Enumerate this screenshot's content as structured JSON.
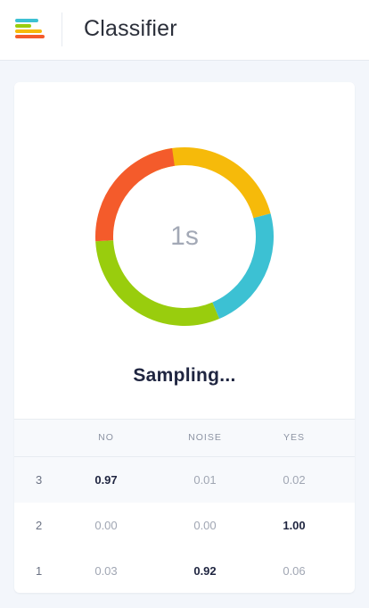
{
  "header": {
    "title": "Classifier",
    "logo_icon": "classifier-logo-icon"
  },
  "status": {
    "timer": "1s",
    "message": "Sampling..."
  },
  "donut": {
    "segments": [
      {
        "color": "#f6ba0a",
        "from_deg": -30,
        "to_deg": 75
      },
      {
        "color": "#3cc1d3",
        "from_deg": 75,
        "to_deg": 157
      },
      {
        "color": "#99cd0d",
        "from_deg": 157,
        "to_deg": 267
      },
      {
        "color": "#f45b2b",
        "from_deg": 267,
        "to_deg": 352
      }
    ]
  },
  "table": {
    "headers": [
      "NO",
      "NOISE",
      "YES"
    ],
    "rows": [
      {
        "index": "3",
        "values": [
          "0.97",
          "0.01",
          "0.02"
        ],
        "max_col": 0
      },
      {
        "index": "2",
        "values": [
          "0.00",
          "0.00",
          "1.00"
        ],
        "max_col": 2
      },
      {
        "index": "1",
        "values": [
          "0.03",
          "0.92",
          "0.06"
        ],
        "max_col": 1
      }
    ]
  }
}
